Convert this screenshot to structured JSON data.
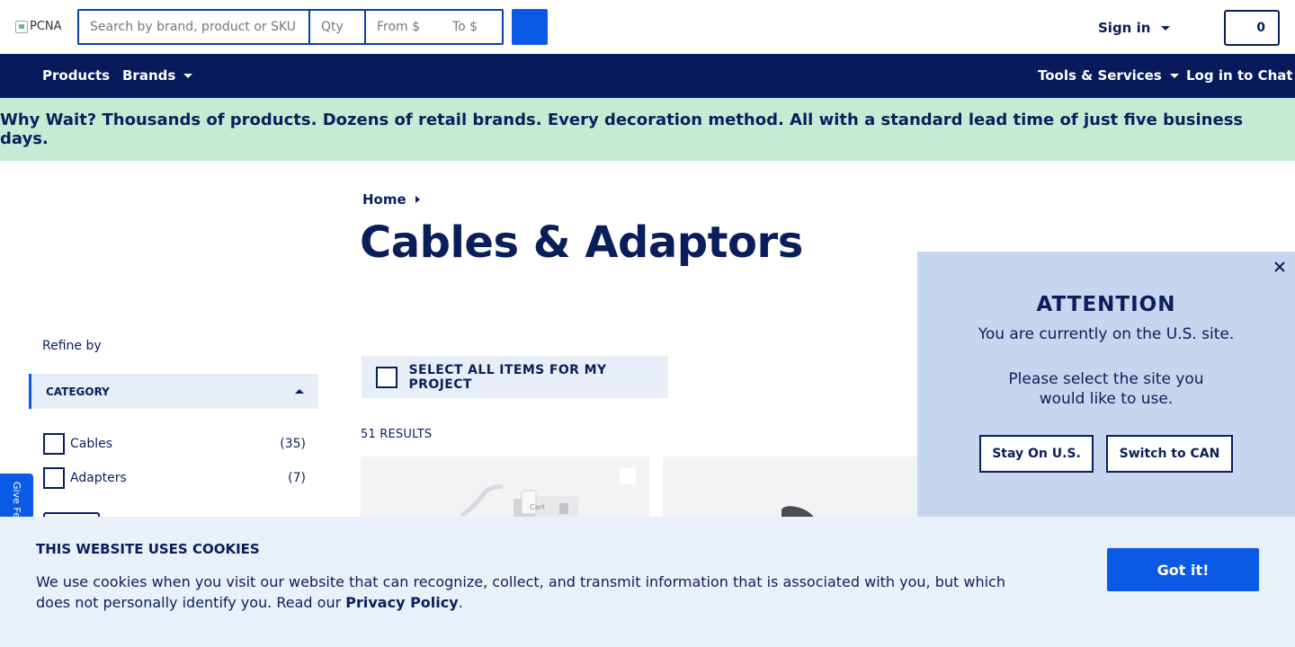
{
  "header": {
    "logo_alt": "PCNA",
    "search_placeholder": "Search by brand, product or SKU",
    "qty_placeholder": "Qty",
    "price_from_placeholder": "From $",
    "price_to_placeholder": "To $",
    "sign_in_label": "Sign in",
    "cart_count": "0"
  },
  "nav": {
    "products": "Products",
    "brands": "Brands",
    "tools_services": "Tools & Services",
    "chat": "Log in to Chat"
  },
  "promo_banner": "Why Wait? Thousands of products. Dozens of retail brands. Every decoration method. All with a standard lead time of just five business days.",
  "breadcrumb": {
    "home": "Home"
  },
  "page_title": "Cables & Adaptors",
  "filters": {
    "refine_label": "Refine by",
    "category_heading": "CATEGORY",
    "items": [
      {
        "label": "Cables",
        "count": "(35)"
      },
      {
        "label": "Adapters",
        "count": "(7)"
      }
    ]
  },
  "select_all_label": "SELECT ALL ITEMS FOR MY PROJECT",
  "results_count": "51 RESULTS",
  "products": [
    {
      "image_text": "Cart"
    },
    {
      "image_text": ""
    }
  ],
  "feedback_tab": "Give Feedback",
  "attention_modal": {
    "title": "ATTENTION",
    "message": "You are currently on the U.S. site.",
    "prompt": "Please select the site you would like to use.",
    "stay_button": "Stay On U.S.",
    "switch_button": "Switch to CAN"
  },
  "cookie_banner": {
    "title": "THIS WEBSITE USES COOKIES",
    "text": "We use cookies when you visit our website that can recognize, collect, and transmit information that is associated with you, but which does not personally identify you. Read our",
    "link": "Privacy Policy",
    "suffix": ".",
    "button": "Got it!"
  },
  "colors": {
    "navy": "#071a5c",
    "accent_blue": "#0a5ae6",
    "promo_green": "#c4ecd5",
    "modal_bg": "#c6d6ee",
    "cookie_bg": "#eaf0f9"
  }
}
